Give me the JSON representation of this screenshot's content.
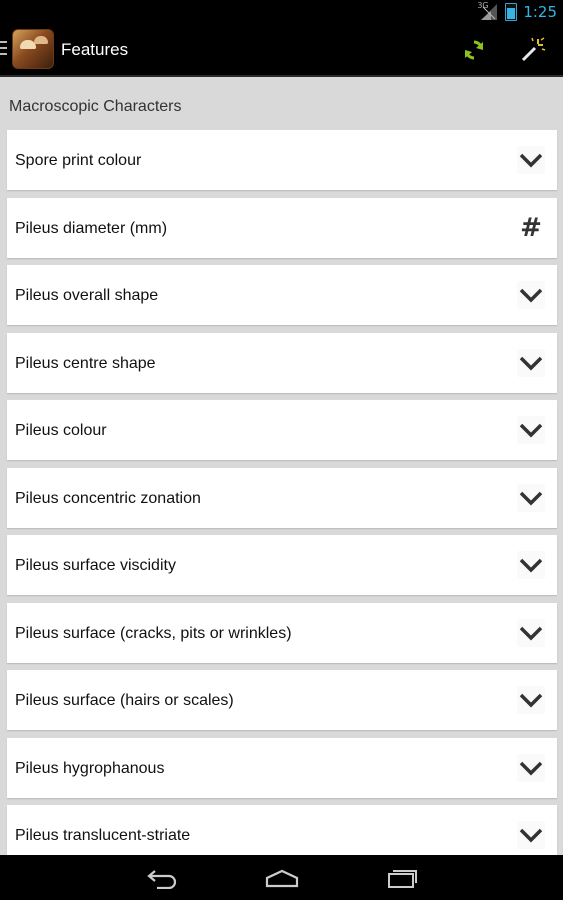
{
  "status_bar": {
    "network_label": "3G",
    "time": "1:25"
  },
  "action_bar": {
    "title": "Features",
    "refresh_icon": "refresh-icon",
    "wand_icon": "magic-wand-icon"
  },
  "section": {
    "title": "Macroscopic Characters"
  },
  "features": [
    {
      "label": "Spore print colour",
      "control": "dropdown"
    },
    {
      "label": "Pileus diameter (mm)",
      "control": "number"
    },
    {
      "label": "Pileus overall shape",
      "control": "dropdown"
    },
    {
      "label": "Pileus centre shape",
      "control": "dropdown"
    },
    {
      "label": "Pileus colour",
      "control": "dropdown"
    },
    {
      "label": "Pileus concentric zonation",
      "control": "dropdown"
    },
    {
      "label": "Pileus surface viscidity",
      "control": "dropdown"
    },
    {
      "label": "Pileus surface (cracks, pits or wrinkles)",
      "control": "dropdown"
    },
    {
      "label": "Pileus surface (hairs or scales)",
      "control": "dropdown"
    },
    {
      "label": "Pileus hygrophanous",
      "control": "dropdown"
    },
    {
      "label": "Pileus translucent-striate",
      "control": "dropdown"
    }
  ],
  "colors": {
    "accent": "#33b5e5",
    "refresh": "#8dc21f"
  }
}
